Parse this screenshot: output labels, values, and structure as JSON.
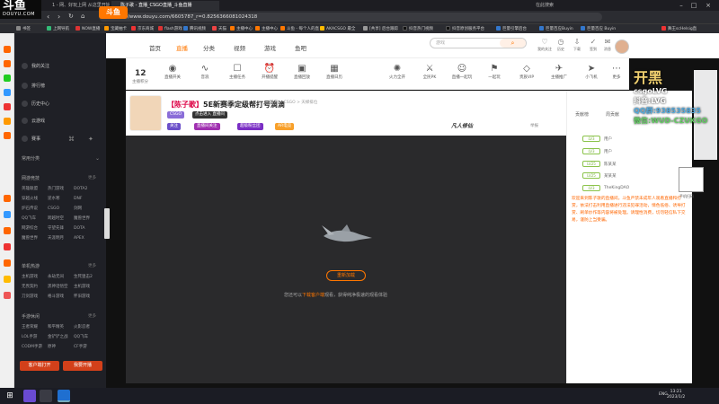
{
  "browser": {
    "tabs": [
      "1 - 网、好玩上网 从这里开始",
      "陈子歌 - 直播_CSGO直播_斗鱼直播",
      "在此搜索"
    ],
    "url": "https://www.douyu.com/6605787_r=0.8256366081024318",
    "bookmarks": [
      "书签",
      "上网导航",
      "NOW直播",
      "宝藏抽卡",
      "京东商城",
      "flash游戏",
      "腾讯视频",
      "天猫",
      "主播中心",
      "主播中心",
      "斗鱼 - 每个人的直",
      "AKACSGO 最全",
      "[共享] 后台跟踪",
      "抖音热门视频",
      "抖音原创服务平台",
      "巨量引擎后台",
      "巨量百应Buyin",
      "巨量百应 Buyin",
      "舞王scHelsig直"
    ],
    "logo_overlay": "斗鱼",
    "logo_overlay_sub": "DOUYU.COM"
  },
  "sidebar": {
    "top_items": [
      "我的关注",
      "排行榜",
      "历史中心",
      "云游戏",
      "赛事"
    ],
    "common_title": "常用分类",
    "sections": [
      {
        "title": "网游竞技",
        "more": "更多",
        "items": [
          "英雄联盟",
          "热门游戏",
          "DOTA2",
          "穿越火线",
          "逆水寒",
          "DNF",
          "炉石传说",
          "CSGO",
          "剑网",
          "QQ飞车",
          "跨越时空",
          "魔兽世界",
          "网游综合",
          "守望先锋",
          "DOTA",
          "魔兽世界",
          "天涯明月",
          "APEX"
        ]
      },
      {
        "title": "单机热游",
        "more": "更多",
        "items": [
          "主机游戏",
          "永劫无间",
          "生死狙击2",
          "无畏契约",
          "黑神话悟空",
          "主机游戏",
          "刀剑游戏",
          "格斗游戏",
          "怀旧游戏"
        ]
      },
      {
        "title": "手游休闲",
        "more": "更多",
        "items": [
          "王者荣耀",
          "和平精英",
          "火影忍者",
          "LOL手游",
          "金铲铲之战",
          "QQ飞车",
          "CODM手游",
          "原神",
          "CF手游"
        ]
      }
    ],
    "btn_client": "客户端打开",
    "btn_live": "我要开播"
  },
  "header": {
    "site_logo": "斗鱼",
    "nav": [
      "首页",
      "直播",
      "分类",
      "视频",
      "游戏",
      "鱼吧"
    ],
    "search_placeholder": "游戏",
    "icons": [
      "我的关注",
      "历史",
      "下载",
      "签到",
      "任务",
      "消息",
      "个人"
    ]
  },
  "toolbar": {
    "level_count": "12",
    "level_label": "主播积分",
    "items": [
      "直播开关",
      "音浪",
      "主播任务",
      "开播提醒",
      "直播回放",
      "直播日历",
      "火力全开",
      "全民PK",
      "直播一起玩",
      "一起玩",
      "贵族VIP",
      "主播推广",
      "小飞机",
      "更多"
    ]
  },
  "stream": {
    "title_prefix": "【陈子歌】",
    "title": "5E新赛季定级帮打号滴滴",
    "category": "CSGO",
    "breadcrumb": "网游 > CSGO > 天梯排位",
    "follow": "关注",
    "tags": [
      "点击进入 直播间",
      "直播间关注",
      "超级粉丝团",
      "AR电竞",
      "新粉丝团"
    ],
    "sponsor": "凡人修仙",
    "share": "分享",
    "report": "举报"
  },
  "player": {
    "retry_label": "重新加载",
    "message_prefix": "您还可以",
    "message_link": "下载客户端",
    "message_suffix": "观看，获得纯净极速的观看体验"
  },
  "rightpanel": {
    "tabs": [
      "贡献榜",
      "周贡献",
      "粉丝团"
    ],
    "rows": [
      {
        "level": "LV3",
        "name": "用户"
      },
      {
        "level": "LV3",
        "name": "用户"
      },
      {
        "level": "LV25",
        "name": "陈某某"
      },
      {
        "level": "LV25",
        "name": "某某某"
      },
      {
        "level": "LV3",
        "name": "用户hbye"
      },
      {
        "level": "LV3",
        "name": "TheKingDAO"
      }
    ],
    "chat_message": "欢迎来到陈子歌的直播间。斗鱼严禁未成年人观看直播和打赏，依法打击利用直播进行违法犯罪活动，情色低俗、诱导打赏、刷单炒作等内容将被处理。请理性消费，切勿轻信私下交易，谨防上当受骗。"
  },
  "overlay": {
    "brand_big": "开黑",
    "brand": "csgoLVG",
    "douyin": "抖音:LVG",
    "qq": "QQ群:938535835",
    "wechat": "微信:WUD-CZUKGO",
    "qr_caption": "手机扫码"
  },
  "taskbar": {
    "lang": "ENG",
    "time": "13:21",
    "date": "2023/1/2"
  }
}
